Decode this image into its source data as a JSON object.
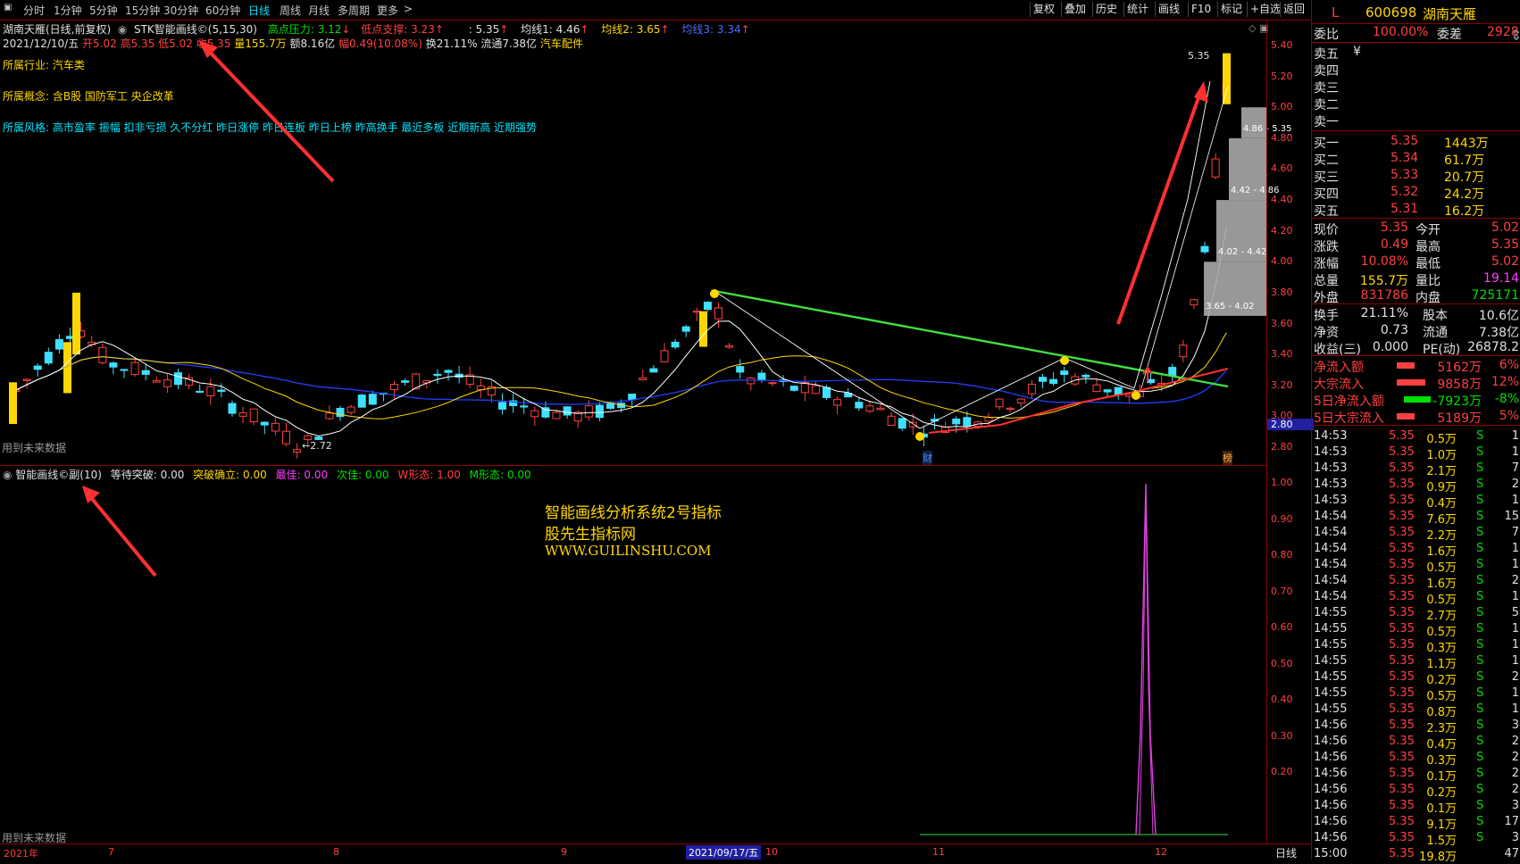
{
  "toolbar": {
    "periods": [
      "分时",
      "1分钟",
      "5分钟",
      "15分钟",
      "30分钟",
      "60分钟",
      "日线",
      "周线",
      "月线",
      "多周期",
      "更多"
    ],
    "active": "日线",
    "right_buttons": [
      "复权",
      "叠加",
      "历史",
      "统计",
      "画线",
      "F10",
      "标记",
      "+自选",
      "返回"
    ]
  },
  "main_header": {
    "title": "湖南天雁(日线,前复权)",
    "indicator": "STK智能画线©(5,15,30)",
    "high_pressure": "高点压力: 3.12",
    "low_support": "低点支撑: 3.23",
    "val1": ": 5.35",
    "ma1": "均线1: 4.46",
    "ma2": "均线2: 3.65",
    "ma3": "均线3: 3.34"
  },
  "quote_line": {
    "date": "2021/12/10/五",
    "open": "开5.02",
    "high": "高5.35",
    "low": "低5.02",
    "close": "收5.35",
    "volume": "量155.7万",
    "amount": "额8.16亿",
    "range": "幅0.49(10.08%)",
    "turnover": "换21.11%",
    "float": "流通7.38亿",
    "sector": "汽车配件"
  },
  "info": {
    "industry_label": "所属行业:",
    "industry": "汽车类",
    "concept_label": "所属概念:",
    "concept": "含B股 国防军工 央企改革",
    "style_label": "所属风格:",
    "style": "高市盈率 振幅 扣非亏损 久不分红 昨日涨停 昨日连板 昨日上榜 昨高换手 最近多板 近期新高 近期强势"
  },
  "annotations": {
    "future_data_1": "用到未来数据",
    "future_data_2": "用到未来数据",
    "low_mark": "←2.72",
    "high_mark": "5.35",
    "cai": "财",
    "bang": "榜",
    "boxes": [
      "4.86 - 5.35",
      "4.42 - 4.86",
      "4.02 - 4.42",
      "3.65 - 4.02"
    ],
    "current_price_tag": "2.80"
  },
  "sub_header": {
    "title": "智能画线©副(10)",
    "wait": "等待突破: 0.00",
    "confirm": "突破确立: 0.00",
    "best": "最佳: 0.00",
    "second": "次佳: 0.00",
    "w_shape": "W形态: 1.00",
    "m_shape": "M形态: 0.00"
  },
  "watermark": {
    "line1": "智能画线分析系统2号指标",
    "line2": "股先生指标网",
    "line3": "WWW.GUILINSHU.COM"
  },
  "axis_main": [
    "5.40",
    "5.20",
    "5.00",
    "4.80",
    "4.60",
    "4.40",
    "4.20",
    "4.00",
    "3.80",
    "3.60",
    "3.40",
    "3.20",
    "3.00",
    "2.80"
  ],
  "axis_sub": [
    "1.00",
    "0.90",
    "0.80",
    "0.70",
    "0.60",
    "0.50",
    "0.40",
    "0.30",
    "0.20"
  ],
  "date_axis": {
    "labels": [
      "2021年",
      "7",
      "8",
      "9",
      "10",
      "11",
      "12"
    ],
    "highlight": "2021/09/17/五",
    "period": "日线"
  },
  "panel": {
    "code": "600698",
    "name": "湖南天雁",
    "flag": "L",
    "weibi_label": "委比",
    "weibi": "100.00%",
    "weicha_label": "委差",
    "weicha": "2928",
    "sell": [
      {
        "label": "卖五",
        "mark": "¥"
      },
      {
        "label": "卖四"
      },
      {
        "label": "卖三"
      },
      {
        "label": "卖二"
      },
      {
        "label": "卖一"
      }
    ],
    "buy": [
      {
        "label": "买一",
        "price": "5.35",
        "vol": "1443万"
      },
      {
        "label": "买二",
        "price": "5.34",
        "vol": "61.7万"
      },
      {
        "label": "买三",
        "price": "5.33",
        "vol": "20.7万"
      },
      {
        "label": "买四",
        "price": "5.32",
        "vol": "24.2万"
      },
      {
        "label": "买五",
        "price": "5.31",
        "vol": "16.2万"
      }
    ],
    "stats": [
      {
        "l1": "现价",
        "v1": "5.35",
        "l2": "今开",
        "v2": "5.02"
      },
      {
        "l1": "涨跌",
        "v1": "0.49",
        "l2": "最高",
        "v2": "5.35"
      },
      {
        "l1": "涨幅",
        "v1": "10.08%",
        "l2": "最低",
        "v2": "5.02"
      },
      {
        "l1": "总量",
        "v1": "155.7万",
        "l2": "量比",
        "v2": "19.14"
      },
      {
        "l1": "外盘",
        "v1": "831786",
        "l2": "内盘",
        "v2": "725171"
      }
    ],
    "stats2": [
      {
        "l1": "换手",
        "v1": "21.11%",
        "l2": "股本",
        "v2": "10.6亿"
      },
      {
        "l1": "净资",
        "v1": "0.73",
        "l2": "流通",
        "v2": "7.38亿"
      },
      {
        "l1": "收益(三)",
        "v1": "0.000",
        "l2": "PE(动)",
        "v2": "26878.2"
      }
    ],
    "flows": [
      {
        "label": "净流入额",
        "value": "5162万",
        "pct": "6%",
        "color": "#ff4040"
      },
      {
        "label": "大宗流入",
        "value": "9858万",
        "pct": "12%",
        "color": "#ff4040"
      },
      {
        "label": "5日净流入额",
        "value": "-7923万",
        "pct": "-8%",
        "color": "#00e000"
      },
      {
        "label": "5日大宗流入",
        "value": "5189万",
        "pct": "5%",
        "color": "#ff4040"
      }
    ],
    "ticks": [
      {
        "t": "14:53",
        "p": "5.35",
        "v": "0.5万",
        "s": "S",
        "n": "1"
      },
      {
        "t": "14:53",
        "p": "5.35",
        "v": "1.0万",
        "s": "S",
        "n": "1"
      },
      {
        "t": "14:53",
        "p": "5.35",
        "v": "2.1万",
        "s": "S",
        "n": "7"
      },
      {
        "t": "14:53",
        "p": "5.35",
        "v": "0.9万",
        "s": "S",
        "n": "2"
      },
      {
        "t": "14:53",
        "p": "5.35",
        "v": "0.4万",
        "s": "S",
        "n": "1"
      },
      {
        "t": "14:54",
        "p": "5.35",
        "v": "7.6万",
        "s": "S",
        "n": "15"
      },
      {
        "t": "14:54",
        "p": "5.35",
        "v": "2.2万",
        "s": "S",
        "n": "7"
      },
      {
        "t": "14:54",
        "p": "5.35",
        "v": "1.6万",
        "s": "S",
        "n": "1"
      },
      {
        "t": "14:54",
        "p": "5.35",
        "v": "0.5万",
        "s": "S",
        "n": "1"
      },
      {
        "t": "14:54",
        "p": "5.35",
        "v": "1.6万",
        "s": "S",
        "n": "2"
      },
      {
        "t": "14:54",
        "p": "5.35",
        "v": "0.5万",
        "s": "S",
        "n": "1"
      },
      {
        "t": "14:55",
        "p": "5.35",
        "v": "2.7万",
        "s": "S",
        "n": "5"
      },
      {
        "t": "14:55",
        "p": "5.35",
        "v": "0.5万",
        "s": "S",
        "n": "1"
      },
      {
        "t": "14:55",
        "p": "5.35",
        "v": "0.3万",
        "s": "S",
        "n": "1"
      },
      {
        "t": "14:55",
        "p": "5.35",
        "v": "1.1万",
        "s": "S",
        "n": "1"
      },
      {
        "t": "14:55",
        "p": "5.35",
        "v": "0.2万",
        "s": "S",
        "n": "2"
      },
      {
        "t": "14:55",
        "p": "5.35",
        "v": "0.5万",
        "s": "S",
        "n": "1"
      },
      {
        "t": "14:55",
        "p": "5.35",
        "v": "0.8万",
        "s": "S",
        "n": "1"
      },
      {
        "t": "14:56",
        "p": "5.35",
        "v": "2.3万",
        "s": "S",
        "n": "3"
      },
      {
        "t": "14:56",
        "p": "5.35",
        "v": "0.4万",
        "s": "S",
        "n": "2"
      },
      {
        "t": "14:56",
        "p": "5.35",
        "v": "0.3万",
        "s": "S",
        "n": "2"
      },
      {
        "t": "14:56",
        "p": "5.35",
        "v": "0.1万",
        "s": "S",
        "n": "2"
      },
      {
        "t": "14:56",
        "p": "5.35",
        "v": "0.2万",
        "s": "S",
        "n": "2"
      },
      {
        "t": "14:56",
        "p": "5.35",
        "v": "0.1万",
        "s": "S",
        "n": "3"
      },
      {
        "t": "14:56",
        "p": "5.35",
        "v": "9.1万",
        "s": "S",
        "n": "17"
      },
      {
        "t": "14:56",
        "p": "5.35",
        "v": "1.5万",
        "s": "S",
        "n": "3"
      },
      {
        "t": "15:00",
        "p": "5.35",
        "v": "19.8万",
        "s": "",
        "n": "47"
      }
    ]
  },
  "colors": {
    "up": "#ff4040",
    "down": "#40e0ff",
    "ma_white": "#ffffff",
    "ma_yellow": "#ffd700",
    "ma_blue": "#2040ff",
    "trend_green": "#40e040",
    "magenta": "#e040e0"
  }
}
